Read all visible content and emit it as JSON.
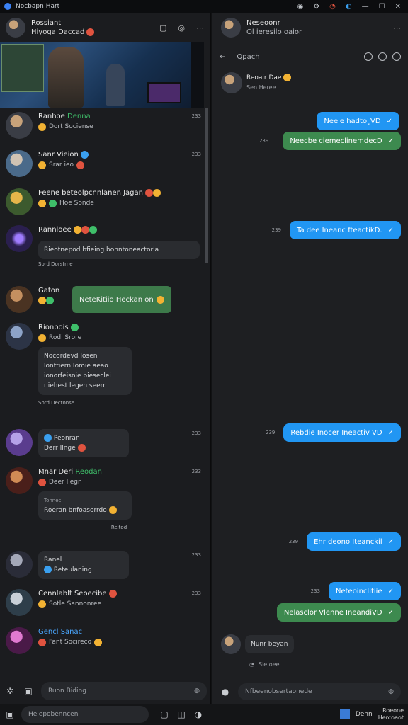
{
  "app": {
    "title": "Nocbapn Hart",
    "controls": [
      "◉",
      "⚙",
      "◔",
      "◐",
      "—",
      "☐",
      "✕"
    ]
  },
  "left": {
    "header": {
      "name": "Rossiant",
      "status": "Hiyoga Daccad",
      "icons": [
        "bookmark-icon",
        "settings-icon",
        "more-icon"
      ]
    },
    "chats": [
      {
        "name": "Ranhoe",
        "tag": "Denna",
        "preview": "Dort Sociense",
        "time": "233"
      },
      {
        "name": "Sanr Vieion",
        "tag": "",
        "preview": "Srar ieo",
        "time": "233"
      },
      {
        "name": "Feene beteolpcnnlanen Jagan",
        "tag": "",
        "preview": "Hoe Sonde",
        "time": ""
      },
      {
        "name": "Rannloee",
        "tag": "",
        "preview": "Rieotnepod bfieing bonntoneactorla",
        "time": "",
        "sub": "Sord Dorstrne"
      },
      {
        "name": "Gaton",
        "tag": "",
        "bubble": "NeteKitiio Heckan on",
        "time": ""
      },
      {
        "name": "Rionbois",
        "tag": "",
        "preview": "Rodi Srore",
        "time": "",
        "multi": "Nocordevd Iosen lonttiern Iomie aeao ionorfeisnie bieseclei niehest legen seerr",
        "foot": "Sord Dectonse"
      },
      {
        "name": "Peonran",
        "tag": "",
        "preview": "Derr Ilnge",
        "time": "233"
      },
      {
        "name": "Mnar Deri",
        "tag": "Reodan",
        "preview": "Deer Ilegn",
        "time": "233",
        "quote": "Tonneci",
        "quote2": "Roeran bnfoasorrdo",
        "foot": "Reitod"
      },
      {
        "name": "Ranel",
        "tag": "",
        "preview": "Reteulaning",
        "time": "233"
      },
      {
        "name": "Cennlablt Seoecibe",
        "tag": "",
        "preview": "Sotle Sannonree",
        "time": "233"
      },
      {
        "name": "Gencl Sanac",
        "tag": "",
        "preview": "Fant Socireco",
        "time": ""
      }
    ],
    "compose": {
      "placeholder": "Ruon Biding"
    },
    "search_placeholder": "Helepobenncen"
  },
  "right": {
    "header": {
      "name": "Neseoonr",
      "status": "Ol ieresilo oaior"
    },
    "subheader": {
      "search": "Qpach"
    },
    "first_msg": {
      "name": "Reoair Dae",
      "sub": "Sen Heree"
    },
    "messages": [
      {
        "text": "Neeie hadto¸VD",
        "color": "blue",
        "time": ""
      },
      {
        "text": "Neecbe ciemeclinemdecD",
        "color": "green",
        "time": "239"
      },
      {
        "text": "Ta dee Ineanc fteactikD.",
        "color": "blue",
        "time": "239"
      },
      {
        "text": "Rebdie Inocer Ineactiv VD",
        "color": "blue",
        "time": "239"
      },
      {
        "text": "Ehr deono Iteanckil",
        "color": "blue",
        "time": "239"
      },
      {
        "text": "Neteoinclitiie",
        "color": "blue",
        "time": "233"
      },
      {
        "text": "Nelasclor Vlenne IneandiVD",
        "color": "green",
        "time": ""
      }
    ],
    "last_in": {
      "text": "Nunr beyan",
      "meta": "Sie oee"
    },
    "compose": {
      "placeholder": "Nfbeenobsertaonede"
    }
  },
  "tray": {
    "label": "Denn",
    "time1": "Roeone",
    "time2": "Hercoaot"
  }
}
